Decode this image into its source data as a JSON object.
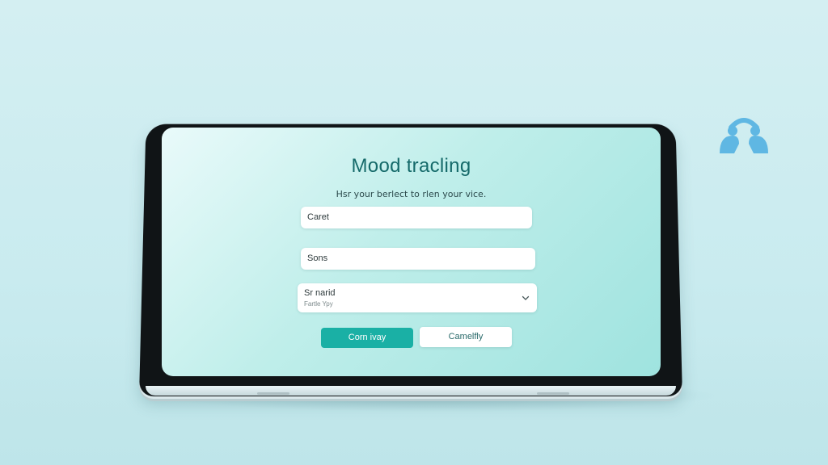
{
  "screen": {
    "title": "Mood tracling",
    "subtitle": "Hsr your berlect to rlen your vice.",
    "fields": {
      "first_value": "Caret",
      "second_value": "Sons",
      "third_value": "Sr narid",
      "third_placeholder": "Fartle Ypy"
    },
    "buttons": {
      "primary_label": "Corn ivay",
      "secondary_label": "Camelfly"
    }
  },
  "icons": {
    "dropdown": "chevron-down-icon",
    "logo": "people-logo-icon"
  },
  "colors": {
    "accent": "#1ab0a5",
    "title": "#156a6a",
    "logo": "#5fb7e3"
  }
}
